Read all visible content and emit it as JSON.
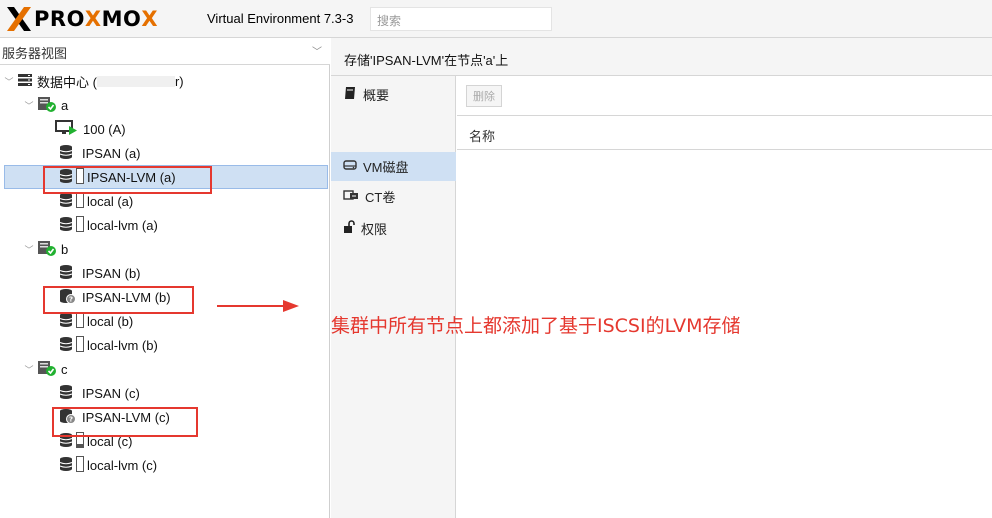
{
  "header": {
    "logo_text_1": "PR",
    "logo_o1": "O",
    "logo_x1": "X",
    "logo_text_2": "M",
    "logo_o2": "O",
    "logo_x2": "X",
    "version": "Virtual Environment 7.3-3",
    "search_placeholder": "搜索"
  },
  "left_panel": {
    "view_selector": "服务器视图",
    "tree": [
      {
        "label": "数据中心 (",
        "suffix": "r)",
        "type": "datacenter"
      },
      {
        "label": "a",
        "type": "node"
      },
      {
        "label": "100 (A)",
        "type": "vm"
      },
      {
        "label": "IPSAN (a)",
        "type": "storage"
      },
      {
        "label": "IPSAN-LVM (a)",
        "type": "storage-sel"
      },
      {
        "label": "local (a)",
        "type": "storage-doc"
      },
      {
        "label": "local-lvm (a)",
        "type": "storage-doc"
      },
      {
        "label": "b",
        "type": "node"
      },
      {
        "label": "IPSAN (b)",
        "type": "storage"
      },
      {
        "label": "IPSAN-LVM (b)",
        "type": "storage-q"
      },
      {
        "label": "local (b)",
        "type": "storage-doc"
      },
      {
        "label": "local-lvm (b)",
        "type": "storage-doc"
      },
      {
        "label": "c",
        "type": "node"
      },
      {
        "label": "IPSAN (c)",
        "type": "storage"
      },
      {
        "label": "IPSAN-LVM (c)",
        "type": "storage-q"
      },
      {
        "label": "local (c)",
        "type": "storage-doc"
      },
      {
        "label": "local-lvm (c)",
        "type": "storage-doc"
      }
    ]
  },
  "right_panel": {
    "title": "存储'IPSAN-LVM'在节点'a'上",
    "nav": [
      {
        "label": "概要",
        "icon": "book-icon"
      },
      {
        "label": "VM磁盘",
        "icon": "hdd-icon"
      },
      {
        "label": "CT卷",
        "icon": "ct-volume-icon"
      },
      {
        "label": "权限",
        "icon": "unlock-icon"
      }
    ],
    "toolbar": {
      "delete_label": "删除"
    },
    "column_name": "名称"
  },
  "annotation": {
    "text": "集群中所有节点上都添加了基于ISCSI的LVM存储"
  },
  "colors": {
    "accent_orange": "#e57000",
    "selection_blue": "#cfe0f3",
    "annotation_red": "#e5382f",
    "node_green": "#21b130"
  }
}
